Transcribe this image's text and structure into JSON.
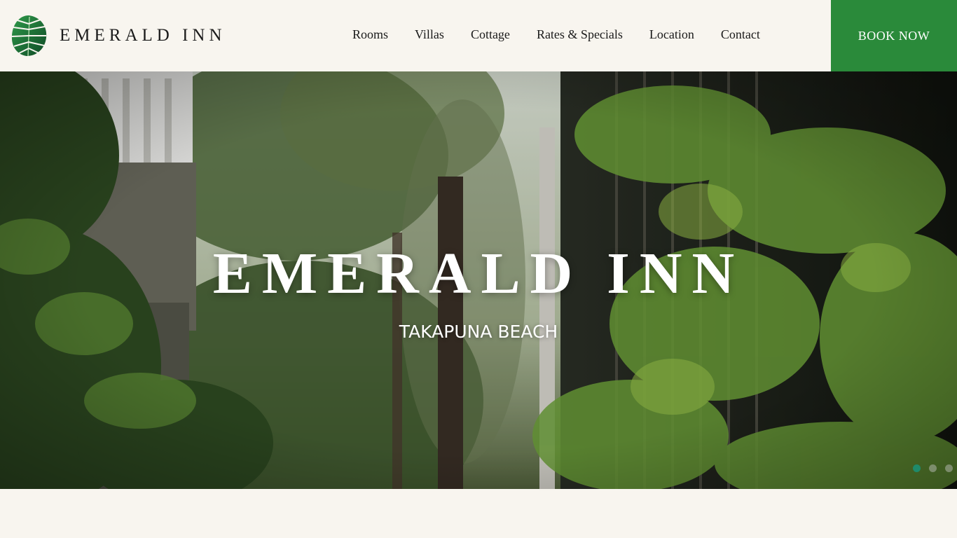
{
  "header": {
    "brand_name": "EMERALD INN",
    "logo_icon": "monstera-leaf-icon",
    "nav": [
      {
        "label": "Rooms"
      },
      {
        "label": "Villas"
      },
      {
        "label": "Cottage"
      },
      {
        "label": "Rates & Specials"
      },
      {
        "label": "Location"
      },
      {
        "label": "Contact"
      }
    ],
    "book_label": "BOOK NOW",
    "book_color": "#2a8a3a",
    "background": "#f8f5ef"
  },
  "hero": {
    "title": "EMERALD INN",
    "subtitle": "TAKAPUNA BEACH",
    "slider": {
      "slide_count": 3,
      "active_index": 0,
      "active_color": "#1f8a6a"
    }
  }
}
